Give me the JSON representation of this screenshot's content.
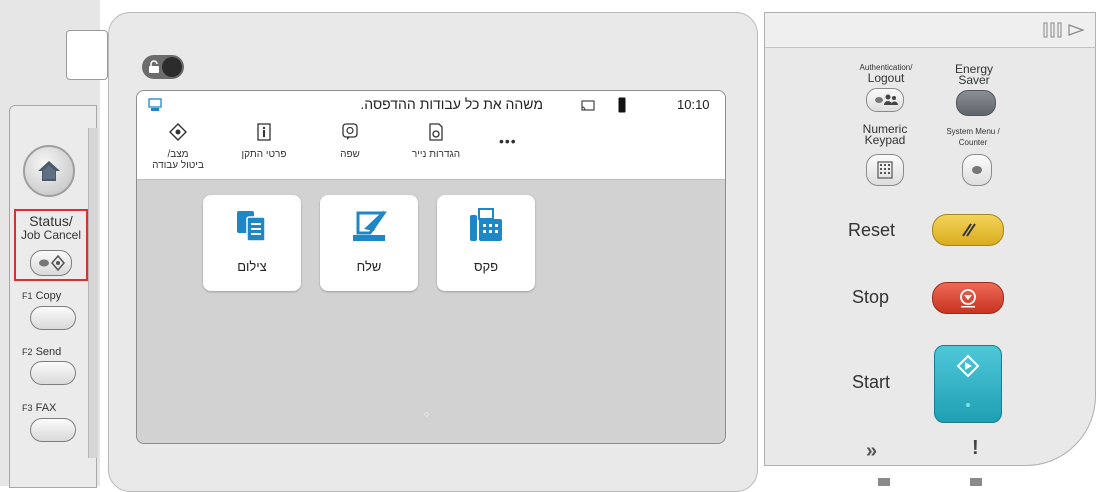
{
  "left": {
    "status_label_1": "Status/",
    "status_label_2": "Job Cancel",
    "copy_fn": "F1",
    "copy_label": "Copy",
    "send_fn": "F2",
    "send_label": "Send",
    "fax_fn": "F3",
    "fax_label": "FAX"
  },
  "display": {
    "message": "משהה את כל עבודות ההדפסה.",
    "time": "10:10",
    "quick_actions": [
      {
        "label_1": "מצב/",
        "label_2": "ביטול עבודה",
        "icon": "status-icon"
      },
      {
        "label_1": "פרטי התקן",
        "label_2": "",
        "icon": "device-info-icon"
      },
      {
        "label_1": "שפה",
        "label_2": "",
        "icon": "language-icon"
      },
      {
        "label_1": "הגדרות נייר",
        "label_2": "",
        "icon": "paper-settings-icon"
      }
    ],
    "more": "•••",
    "tiles": [
      {
        "label": "צילום",
        "icon": "copy-icon"
      },
      {
        "label": "שלח",
        "icon": "send-icon"
      },
      {
        "label": "פקס",
        "icon": "fax-icon"
      }
    ],
    "page_indicator": "○"
  },
  "right": {
    "auth_1": "Authentication/",
    "auth_2": "Logout",
    "energy_1": "Energy",
    "energy_2": "Saver",
    "numeric_1": "Numeric",
    "numeric_2": "Keypad",
    "sysmenu_1": "System Menu /",
    "sysmenu_2": "Counter",
    "reset": "Reset",
    "stop": "Stop",
    "start": "Start",
    "processing_icon": "»",
    "attention_icon": "!"
  },
  "colors": {
    "reset_btn": "#e8c23b",
    "stop_btn": "#d9402b",
    "start_btn": "#2fb3c6",
    "highlight": "#d93030",
    "tile_icon": "#1e87c5"
  }
}
